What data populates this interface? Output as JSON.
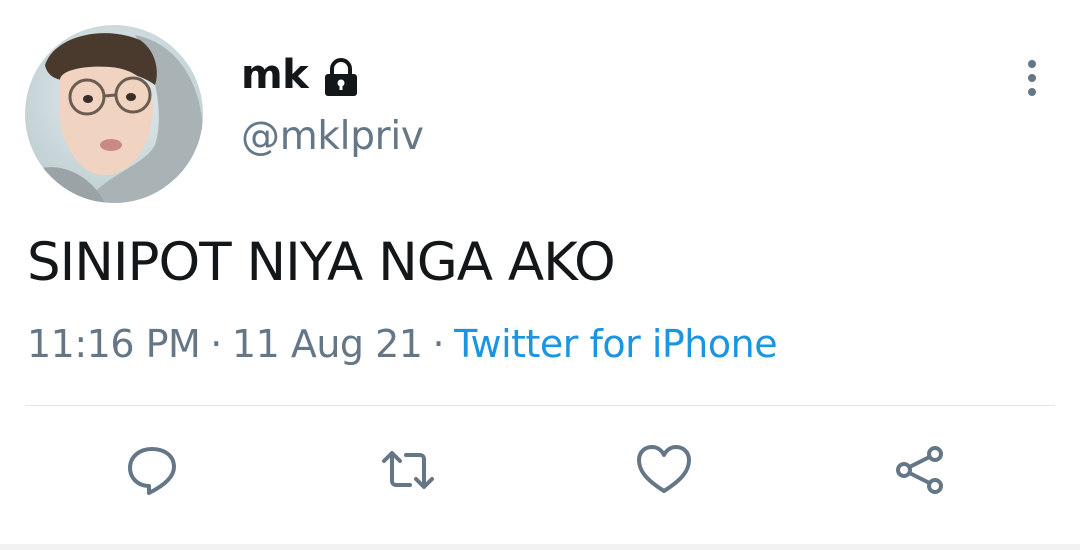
{
  "author": {
    "display_name": "mk",
    "handle": "@mklpriv",
    "protected": true,
    "avatar_icon": "profile-photo"
  },
  "tweet": {
    "text": "SINIPOT NIYA NGA AKO",
    "time": "11:16 PM",
    "separator": "·",
    "date": "11 Aug 21",
    "source": "Twitter for iPhone"
  },
  "actions": {
    "reply_icon": "reply-icon",
    "retweet_icon": "retweet-icon",
    "like_icon": "like-icon",
    "share_icon": "share-icon"
  },
  "colors": {
    "text_primary": "#14171a",
    "text_secondary": "#657786",
    "link": "#1b95e0",
    "icon": "#657786",
    "divider": "#e1e8ed"
  }
}
